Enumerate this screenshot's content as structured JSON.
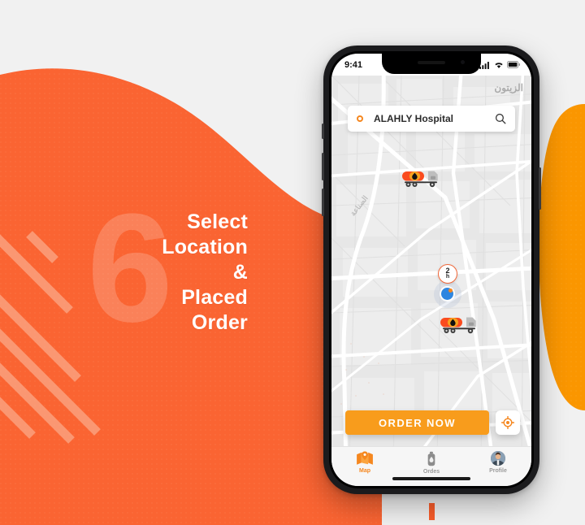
{
  "slide": {
    "step_number": "6",
    "headline_lines": [
      "Select",
      "Location",
      "&",
      "Placed",
      "Order"
    ],
    "accent_color": "#FA6432",
    "accent_light": "#FF8A5B",
    "stripe_color": "#FBB79A",
    "page_background": "#F1F1F1",
    "secondary_shape_color": "#FA9600",
    "progress_tick_color": "#FA5D2B"
  },
  "phone": {
    "statusbar": {
      "time": "9:41",
      "icons": [
        "cellular-signal-icon",
        "wifi-icon",
        "battery-icon"
      ]
    },
    "search": {
      "marker_icon": "location-dot-icon",
      "value": "ALAHLY Hospital",
      "placeholder": "Search location",
      "action_icon": "search-icon"
    },
    "map": {
      "labels": [
        {
          "text": "الزيتون",
          "name": "map-label-zeitoun"
        },
        {
          "text": "الصناعة",
          "name": "map-label-sinaa"
        }
      ],
      "eta_badge": {
        "value": "2",
        "unit": "h"
      },
      "trucks": [
        {
          "name": "fuel-truck-marker-1"
        },
        {
          "name": "fuel-truck-marker-2"
        }
      ],
      "user_location": "current-location-dot",
      "map_base_color": "#E6E6E6",
      "road_color": "#FFFFFF"
    },
    "actions": {
      "order_label": "ORDER NOW",
      "order_color": "#F89C1C",
      "locate_icon": "locate-me-icon"
    },
    "tabs": [
      {
        "label": "Map",
        "icon": "map-pin-icon",
        "active": true
      },
      {
        "label": "Ordes",
        "icon": "fuel-can-icon",
        "active": false
      },
      {
        "label": "Profile",
        "icon": "avatar-icon",
        "active": false
      }
    ]
  }
}
